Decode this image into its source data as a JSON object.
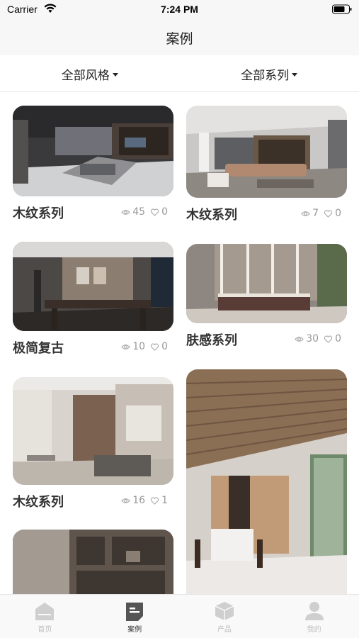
{
  "status_bar": {
    "carrier": "Carrier",
    "time": "7:24 PM"
  },
  "nav": {
    "title": "案例"
  },
  "filters": [
    {
      "label": "全部风格"
    },
    {
      "label": "全部系列"
    }
  ],
  "cards": [
    {
      "title": "木纹系列",
      "views": "45",
      "likes": "0"
    },
    {
      "title": "木纹系列",
      "views": "7",
      "likes": "0"
    },
    {
      "title": "极简复古",
      "views": "10",
      "likes": "0"
    },
    {
      "title": "肤感系列",
      "views": "30",
      "likes": "0"
    },
    {
      "title": "木纹系列",
      "views": "16",
      "likes": "1"
    },
    {
      "title": "",
      "views": "",
      "likes": ""
    },
    {
      "title": "",
      "views": "",
      "likes": ""
    }
  ],
  "tabs": [
    {
      "label": "首页",
      "icon": "home-icon"
    },
    {
      "label": "案例",
      "icon": "case-icon"
    },
    {
      "label": "产品",
      "icon": "product-box-icon"
    },
    {
      "label": "我的",
      "icon": "profile-icon"
    }
  ],
  "colors": {
    "accent_active": "#333333",
    "inactive": "#c8c8c8",
    "muted_text": "#999999"
  }
}
